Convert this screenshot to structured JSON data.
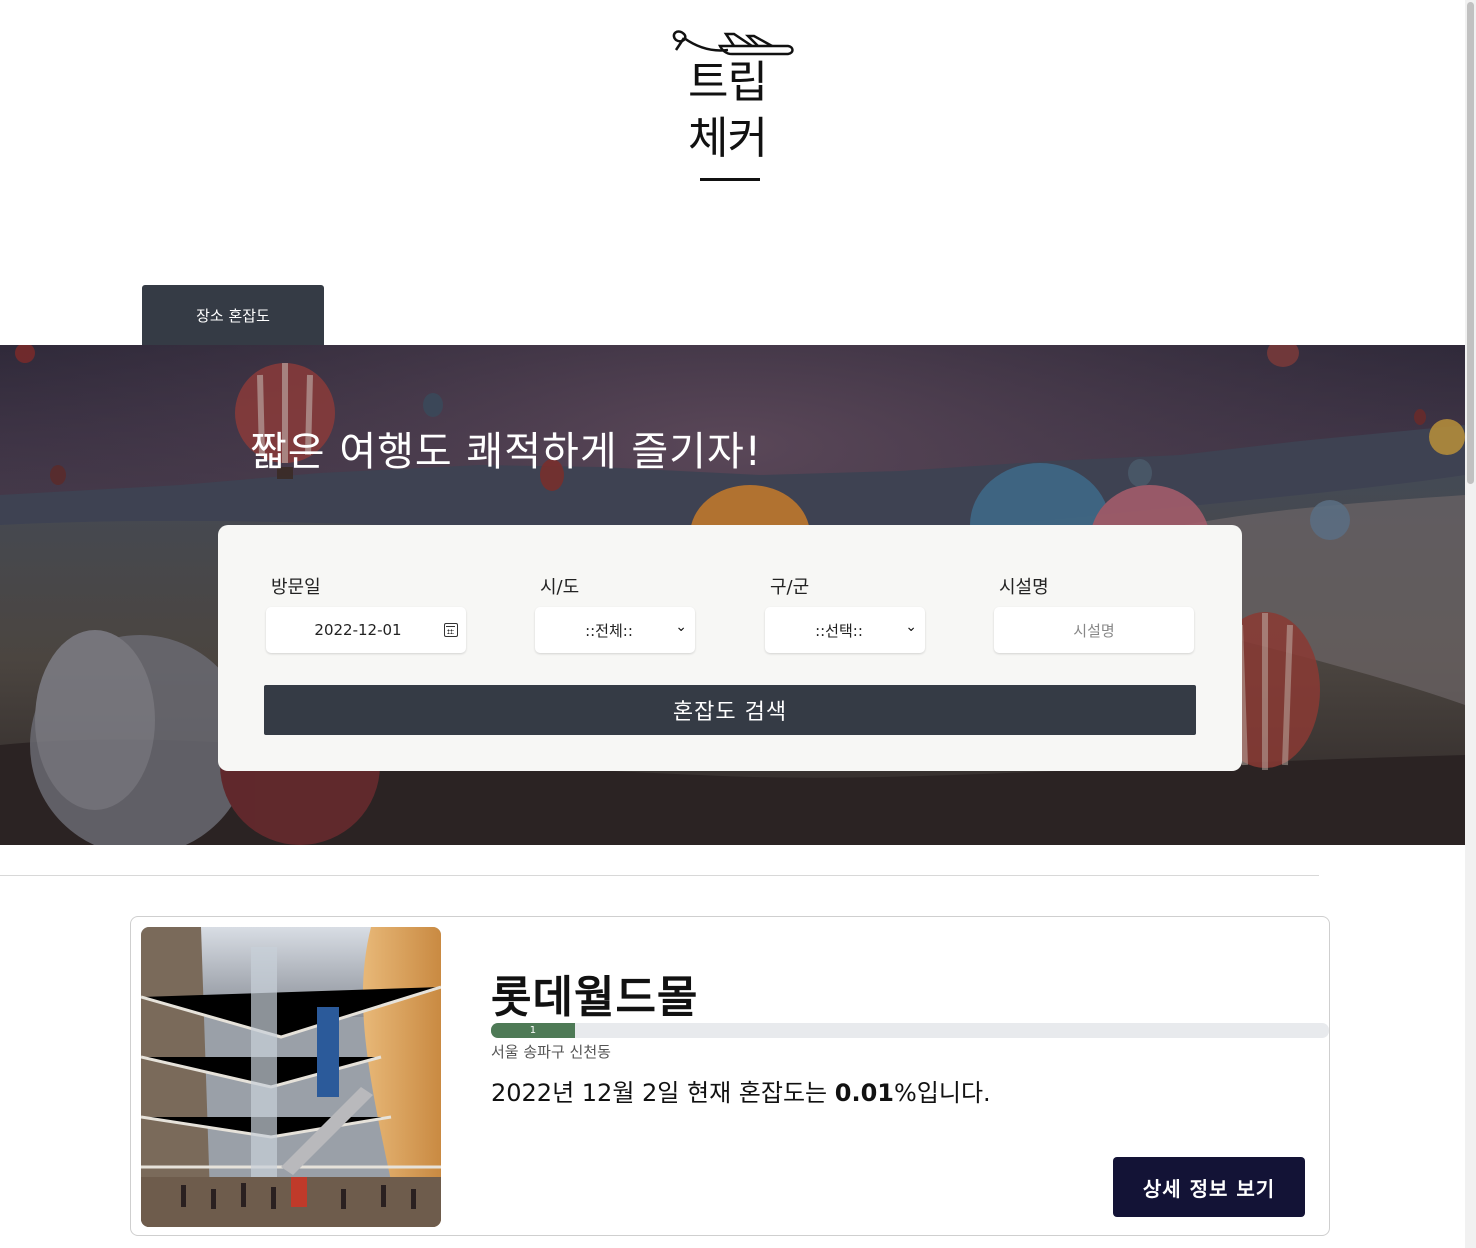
{
  "logo": {
    "line1": "트립",
    "line2": "체커"
  },
  "tab": {
    "label": "장소 혼잡도"
  },
  "hero": {
    "title": "짧은 여행도 쾌적하게 즐기자!"
  },
  "search": {
    "date_label": "방문일",
    "date_value": "2022-12-01",
    "city_label": "시/도",
    "city_value": "::전체::",
    "district_label": "구/군",
    "district_value": "::선택::",
    "facility_label": "시설명",
    "facility_placeholder": "시설명",
    "button_label": "혼잡도 검색"
  },
  "result": {
    "title": "롯데월드몰",
    "progress_value": 1,
    "progress_percent": 10,
    "address": "서울 송파구 신천동",
    "desc_prefix": "2022년 12월 2일 현재 혼잡도는 ",
    "desc_value": "0.01",
    "desc_suffix": "%입니다.",
    "button_label": "상세 정보 보기"
  },
  "colors": {
    "tab_bg": "#353b45",
    "search_button": "#353b45",
    "progress_fill": "#4e7a56",
    "detail_button": "#131336"
  },
  "icons": [
    "airplane-logo-icon",
    "calendar-icon",
    "chevron-down-icon"
  ]
}
